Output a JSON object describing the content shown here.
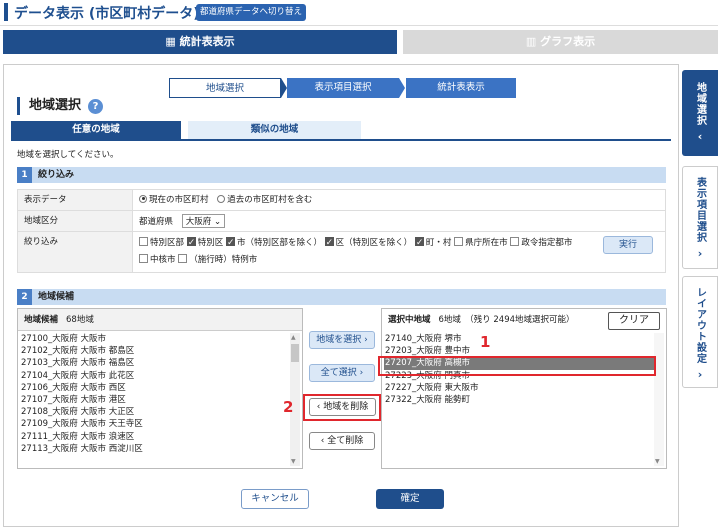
{
  "header": {
    "title": "データ表示 (市区町村データ)",
    "switch_label": "都道府県データへ切り替え"
  },
  "modes": {
    "table": "統計表表示",
    "graph": "グラフ表示"
  },
  "steps": [
    "地域選択",
    "表示項目選択",
    "統計表表示"
  ],
  "section": {
    "title": "地域選択",
    "help": "?"
  },
  "tabs": [
    "任意の地域",
    "類似の地域"
  ],
  "instruction": "地域を選択してください。",
  "filter": {
    "band_num": "1",
    "band_label": "絞り込み",
    "rows": {
      "display_label": "表示データ",
      "display_opt1": "現在の市区町村",
      "display_opt2": "過去の市区町村を含む",
      "area_label": "地域区分",
      "area_text": "都道府県",
      "area_select": "大阪府",
      "narrow_label": "絞り込み",
      "checks": [
        "特別区部",
        "特別区",
        "市（特別区部を除く）",
        "区（特別区を除く）",
        "町・村",
        "県庁所在市",
        "政令指定都市",
        "中核市",
        "（施行時）特例市"
      ],
      "exec": "実行"
    }
  },
  "candidates": {
    "band_num": "2",
    "band_label": "地域候補",
    "left_title": "地域候補",
    "left_count": "68地域",
    "left_items": [
      "27100_大阪府 大阪市",
      "27102_大阪府 大阪市 都島区",
      "27103_大阪府 大阪市 福島区",
      "27104_大阪府 大阪市 此花区",
      "27106_大阪府 大阪市 西区",
      "27107_大阪府 大阪市 港区",
      "27108_大阪府 大阪市 大正区",
      "27109_大阪府 大阪市 天王寺区",
      "27111_大阪府 大阪市 浪速区",
      "27113_大阪府 大阪市 西淀川区"
    ],
    "right_title": "選択中地域",
    "right_count": "6地域　（残り 2494地域選択可能）",
    "clear": "クリア",
    "right_items": [
      "27140_大阪府 堺市",
      "27203_大阪府 豊中市",
      "27207_大阪府 高槻市",
      "27223_大阪府 門真市",
      "27227_大阪府 東大阪市",
      "27322_大阪府 能勢町"
    ],
    "btn_select": "地域を選択",
    "btn_select_all": "全て選択",
    "btn_remove": "地域を削除",
    "btn_remove_all": "全て削除"
  },
  "annotations": {
    "n1": "1",
    "n2": "2"
  },
  "footer": {
    "cancel": "キャンセル",
    "confirm": "確定"
  },
  "sidebar": [
    {
      "label": "地域選択",
      "chev": "‹"
    },
    {
      "label": "表示項目選択",
      "chev": "›"
    },
    {
      "label": "レイアウト設定",
      "chev": "›"
    }
  ]
}
